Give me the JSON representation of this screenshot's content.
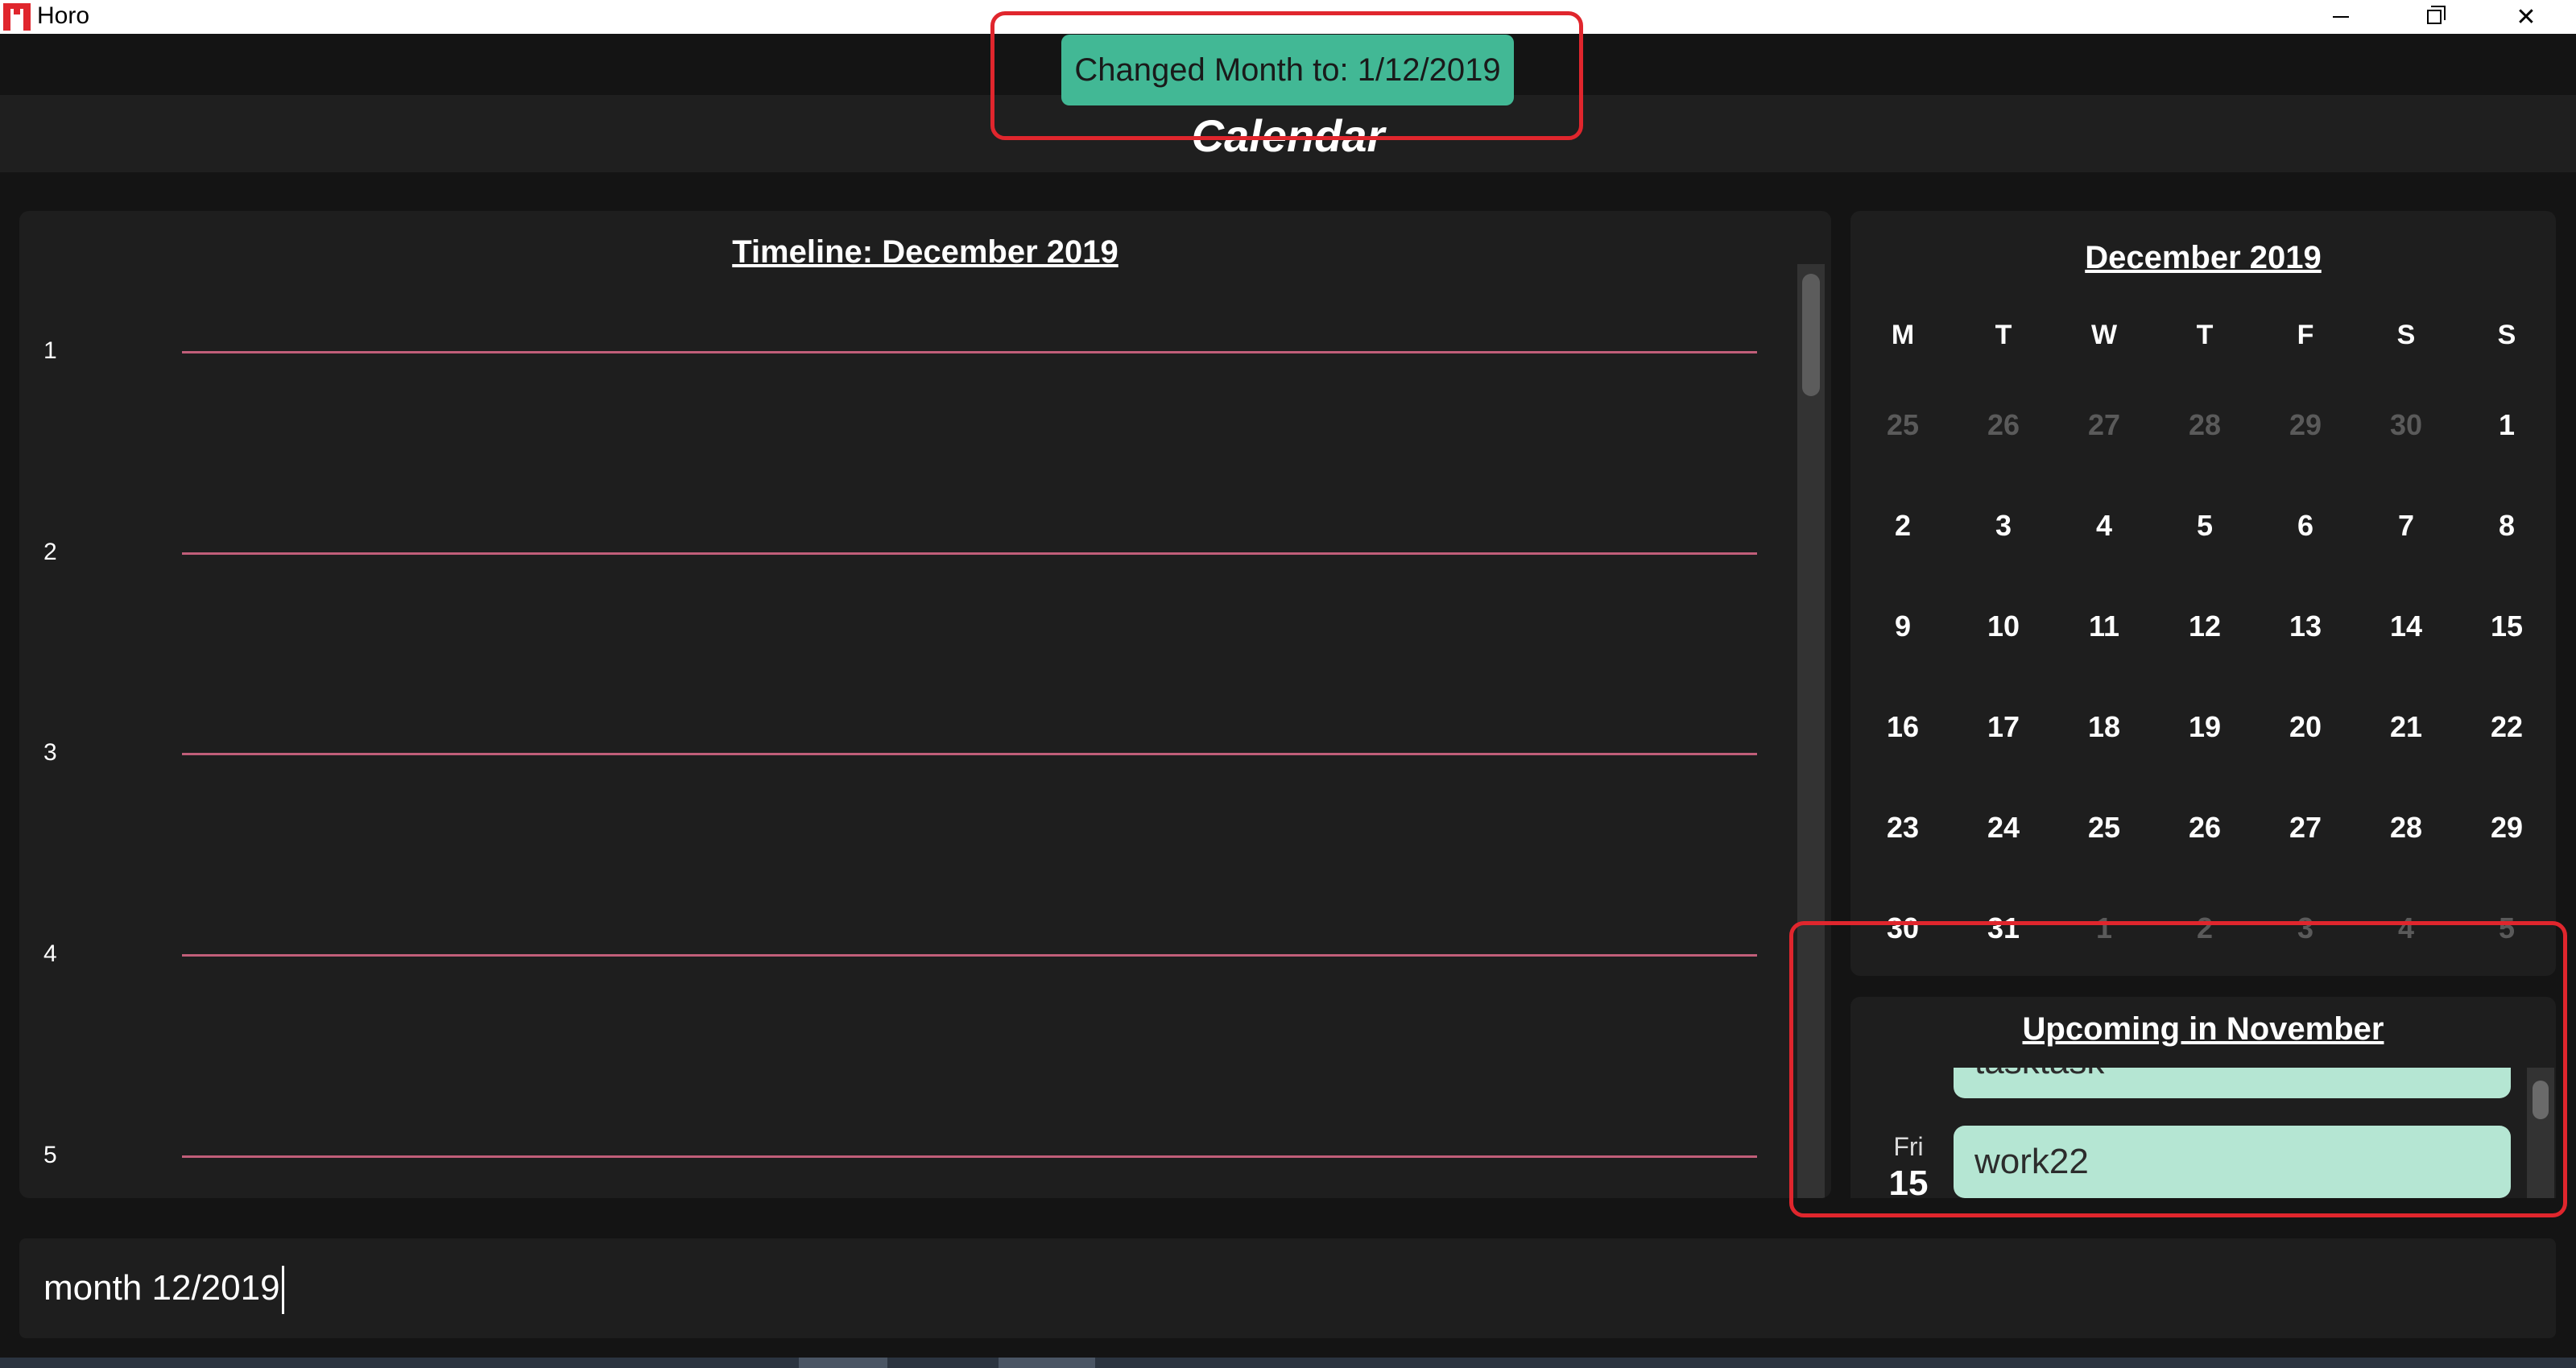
{
  "window": {
    "title": "Horo",
    "controls": [
      "minimize",
      "restore",
      "close"
    ]
  },
  "toast": {
    "text": "Changed Month to: 1/12/2019"
  },
  "header": {
    "title": "Calendar"
  },
  "timeline": {
    "title": "Timeline: December 2019",
    "rows": [
      "1",
      "2",
      "3",
      "4",
      "5"
    ]
  },
  "calendar": {
    "title": "December 2019",
    "weekdays": [
      "M",
      "T",
      "W",
      "T",
      "F",
      "S",
      "S"
    ],
    "weeks": [
      [
        {
          "d": "25",
          "dim": true
        },
        {
          "d": "26",
          "dim": true
        },
        {
          "d": "27",
          "dim": true
        },
        {
          "d": "28",
          "dim": true
        },
        {
          "d": "29",
          "dim": true
        },
        {
          "d": "30",
          "dim": true
        },
        {
          "d": "1",
          "dim": false
        }
      ],
      [
        {
          "d": "2",
          "dim": false
        },
        {
          "d": "3",
          "dim": false
        },
        {
          "d": "4",
          "dim": false
        },
        {
          "d": "5",
          "dim": false
        },
        {
          "d": "6",
          "dim": false
        },
        {
          "d": "7",
          "dim": false
        },
        {
          "d": "8",
          "dim": false
        }
      ],
      [
        {
          "d": "9",
          "dim": false
        },
        {
          "d": "10",
          "dim": false
        },
        {
          "d": "11",
          "dim": false
        },
        {
          "d": "12",
          "dim": false
        },
        {
          "d": "13",
          "dim": false
        },
        {
          "d": "14",
          "dim": false
        },
        {
          "d": "15",
          "dim": false
        }
      ],
      [
        {
          "d": "16",
          "dim": false
        },
        {
          "d": "17",
          "dim": false
        },
        {
          "d": "18",
          "dim": false
        },
        {
          "d": "19",
          "dim": false
        },
        {
          "d": "20",
          "dim": false
        },
        {
          "d": "21",
          "dim": false
        },
        {
          "d": "22",
          "dim": false
        }
      ],
      [
        {
          "d": "23",
          "dim": false
        },
        {
          "d": "24",
          "dim": false
        },
        {
          "d": "25",
          "dim": false
        },
        {
          "d": "26",
          "dim": false
        },
        {
          "d": "27",
          "dim": false
        },
        {
          "d": "28",
          "dim": false
        },
        {
          "d": "29",
          "dim": false
        }
      ],
      [
        {
          "d": "30",
          "dim": false
        },
        {
          "d": "31",
          "dim": false
        },
        {
          "d": "1",
          "dim": true
        },
        {
          "d": "2",
          "dim": true
        },
        {
          "d": "3",
          "dim": true
        },
        {
          "d": "4",
          "dim": true
        },
        {
          "d": "5",
          "dim": true
        }
      ]
    ]
  },
  "upcoming": {
    "title": "Upcoming in November",
    "items": [
      {
        "weekday": "",
        "date": "15",
        "event": "tasktask"
      },
      {
        "weekday": "Fri",
        "date": "15",
        "event": "work22"
      }
    ]
  },
  "command": {
    "value": "month 12/2019"
  },
  "colors": {
    "accent": "#42b895",
    "timeline_line": "#c15e79",
    "event_bg": "#b5e6d3",
    "highlight": "#e0262d"
  }
}
